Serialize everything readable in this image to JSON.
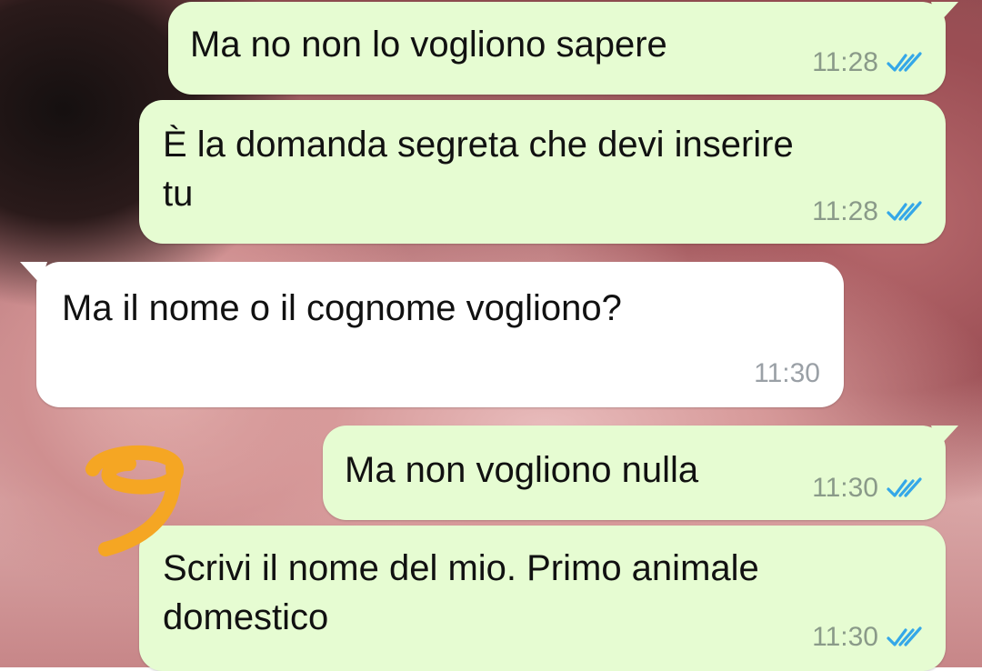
{
  "chat": {
    "messages": [
      {
        "direction": "outgoing",
        "text": "Ma no non lo vogliono sapere",
        "time": "11:28",
        "status": "read"
      },
      {
        "direction": "outgoing",
        "text": "È la domanda segreta che devi inserire\ntu",
        "time": "11:28",
        "status": "read"
      },
      {
        "direction": "incoming",
        "text": "Ma il nome o il cognome vogliono?",
        "time": "11:30"
      },
      {
        "direction": "outgoing",
        "text": "Ma non vogliono nulla",
        "time": "11:30",
        "status": "read"
      },
      {
        "direction": "outgoing",
        "text": "Scrivi il nome del mio. Primo animale\ndomestico",
        "time": "11:30",
        "status": "read"
      }
    ]
  },
  "colors": {
    "outgoing_bubble": "#e6fcd2",
    "incoming_bubble": "#ffffff",
    "read_ticks": "#34a7e8",
    "annotation": "#f5a623"
  },
  "icons": {
    "read_receipt": "double-check-icon",
    "annotation": "handwritten-nine-doodle"
  }
}
